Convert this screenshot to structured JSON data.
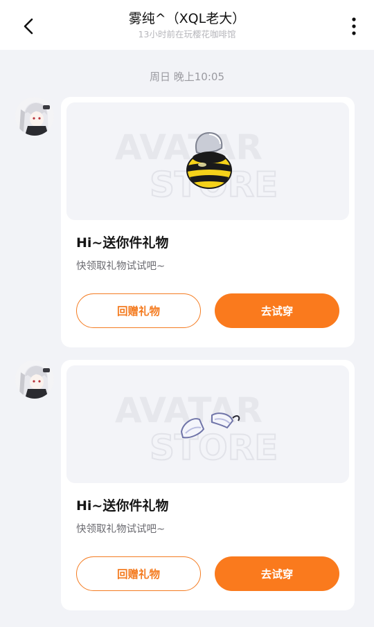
{
  "header": {
    "title": "雾纯^（XQL老大）",
    "subtitle": "13小时前在玩樱花咖啡馆",
    "back_icon": "chevron-left-icon",
    "more_icon": "more-vertical-icon"
  },
  "timestamp": "周日 晚上10:05",
  "watermark": [
    "AVATAR",
    "STORE"
  ],
  "messages": [
    {
      "item_icon": "bee-costume-icon",
      "title": "Hi~送你件礼物",
      "desc": "快领取礼物试试吧~",
      "return_gift_label": "回赠礼物",
      "try_on_label": "去试穿"
    },
    {
      "item_icon": "white-accessory-icon",
      "title": "Hi~送你件礼物",
      "desc": "快领取礼物试试吧~",
      "return_gift_label": "回赠礼物",
      "try_on_label": "去试穿"
    }
  ],
  "colors": {
    "accent": "#fa7a1d",
    "background": "#f2f3f7",
    "card": "#ffffff"
  }
}
